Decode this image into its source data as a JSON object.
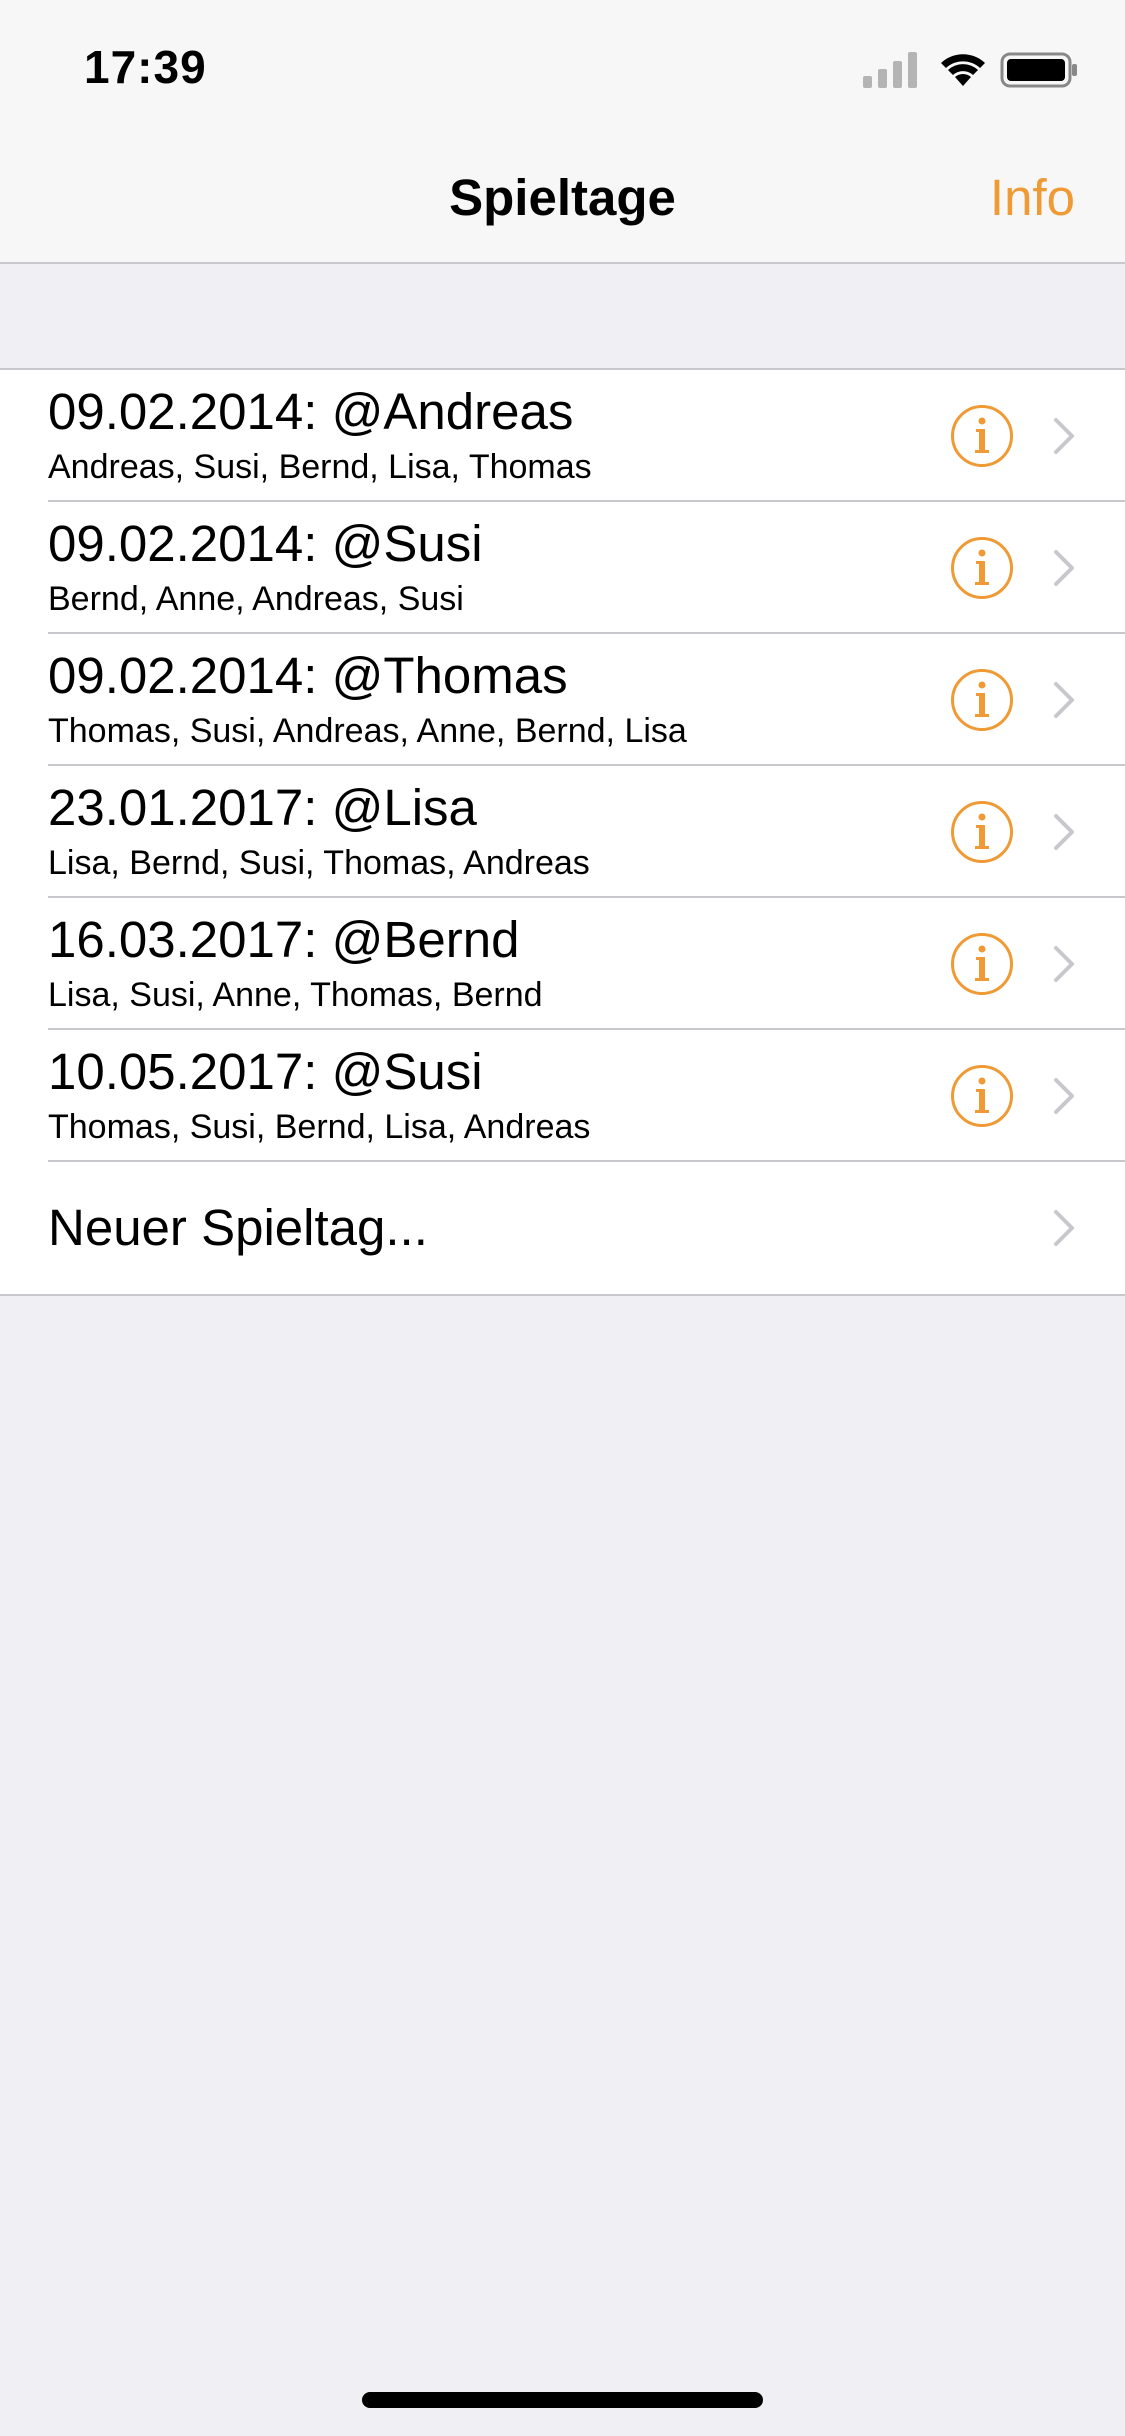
{
  "status": {
    "time": "17:39",
    "icons": [
      "signal-icon",
      "wifi-icon",
      "battery-icon"
    ]
  },
  "nav": {
    "title": "Spieltage",
    "info_label": "Info"
  },
  "colors": {
    "accent": "#ef9a34",
    "separator": "#c8c7cc",
    "background": "#efeff4",
    "chevron": "#c7c7cc"
  },
  "rows": [
    {
      "title": "09.02.2014: @Andreas",
      "subtitle": "Andreas, Susi, Bernd, Lisa, Thomas"
    },
    {
      "title": "09.02.2014: @Susi",
      "subtitle": "Bernd, Anne, Andreas, Susi"
    },
    {
      "title": "09.02.2014: @Thomas",
      "subtitle": "Thomas, Susi, Andreas, Anne, Bernd, Lisa"
    },
    {
      "title": "23.01.2017: @Lisa",
      "subtitle": "Lisa, Bernd, Susi, Thomas, Andreas"
    },
    {
      "title": "16.03.2017: @Bernd",
      "subtitle": "Lisa, Susi, Anne, Thomas, Bernd"
    },
    {
      "title": "10.05.2017: @Susi",
      "subtitle": "Thomas, Susi, Bernd, Lisa, Andreas"
    }
  ],
  "new_row": {
    "label": "Neuer Spieltag..."
  }
}
